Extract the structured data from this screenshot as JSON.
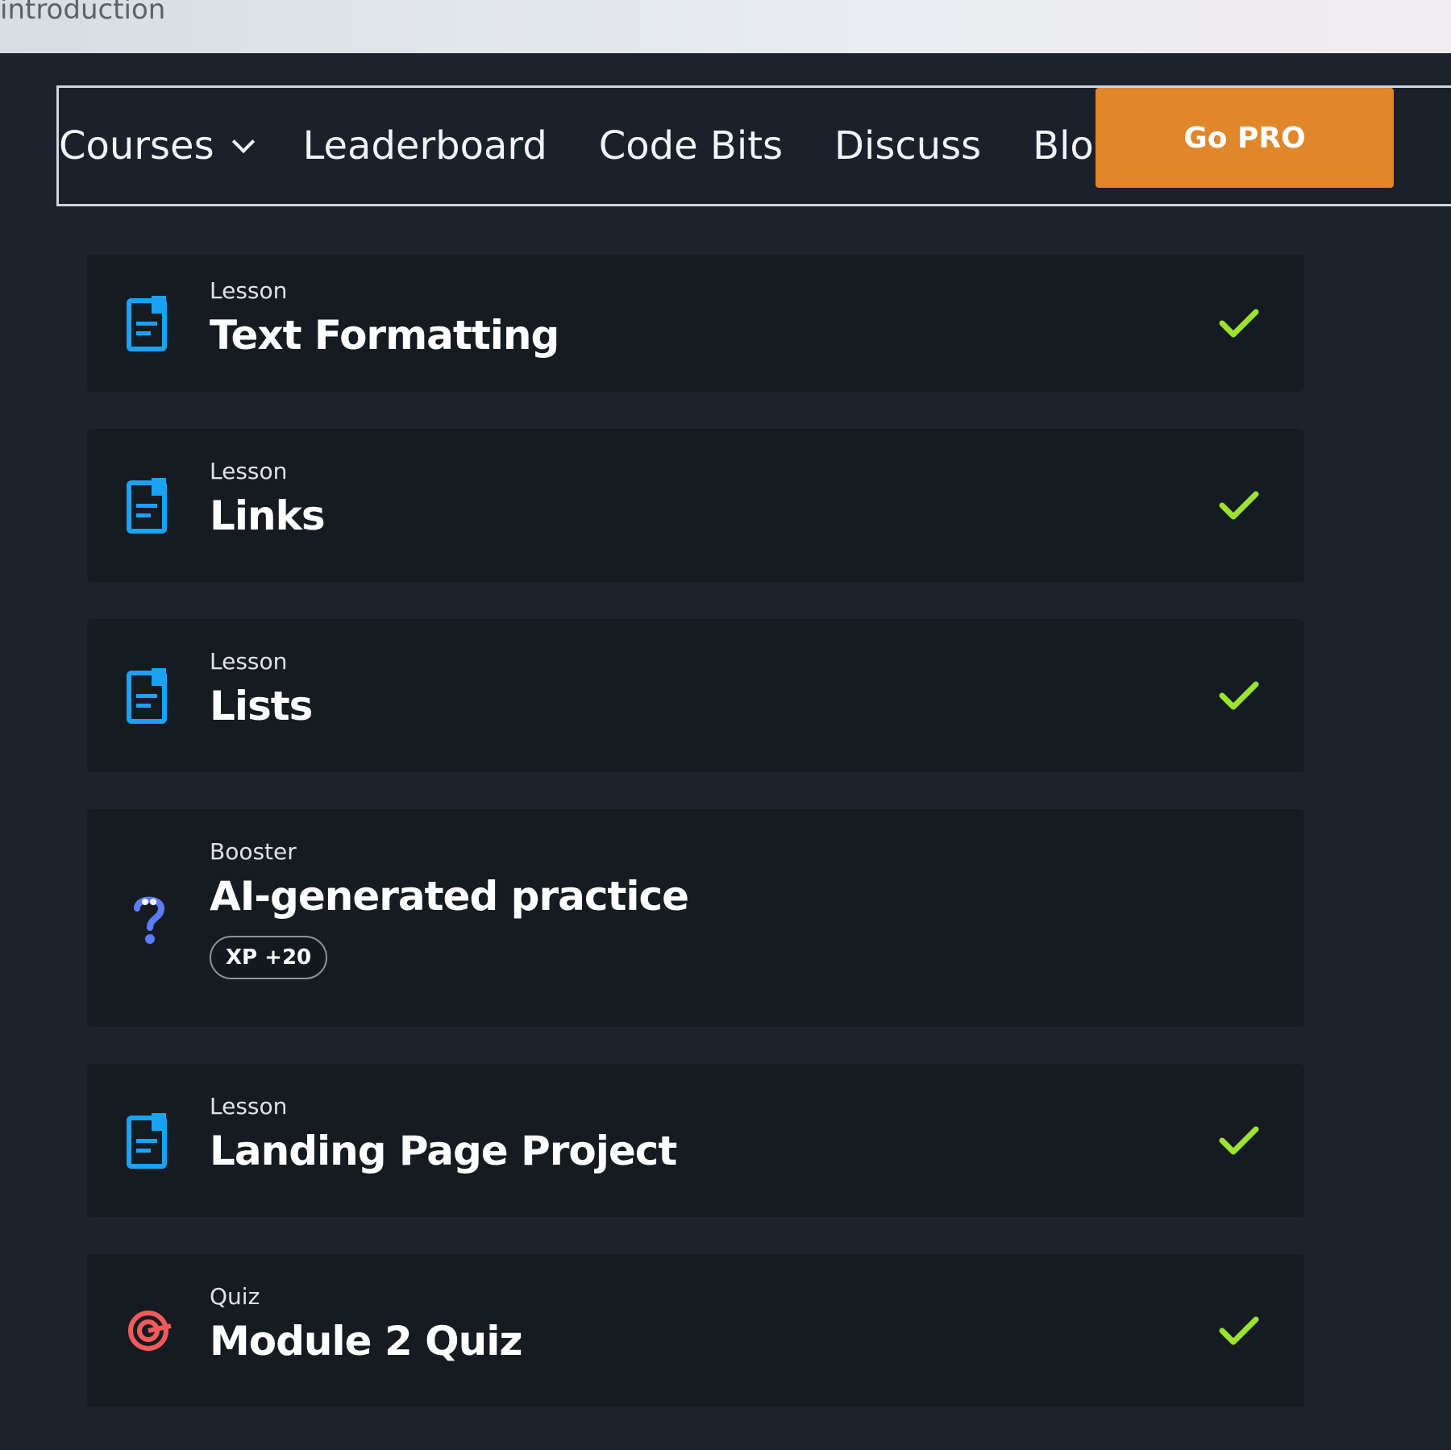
{
  "breadcrumb": "introduction",
  "nav": {
    "items": [
      {
        "label": "Courses",
        "has_dropdown": true
      },
      {
        "label": "Leaderboard"
      },
      {
        "label": "Code Bits"
      },
      {
        "label": "Discuss"
      },
      {
        "label": "Blog"
      }
    ],
    "cta_label": "Go PRO"
  },
  "lessons": [
    {
      "kind": "Lesson",
      "title": "Text Formatting",
      "icon": "lesson-doc-icon",
      "completed": true
    },
    {
      "kind": "Lesson",
      "title": "Links",
      "icon": "lesson-doc-icon",
      "completed": true
    },
    {
      "kind": "Lesson",
      "title": "Lists",
      "icon": "lesson-doc-icon",
      "completed": true
    },
    {
      "kind": "Booster",
      "title": "AI-generated practice",
      "icon": "booster-question-icon",
      "completed": false,
      "badge": "XP +20"
    },
    {
      "kind": "Lesson",
      "title": "Landing Page Project",
      "icon": "lesson-doc-icon",
      "completed": true
    },
    {
      "kind": "Quiz",
      "title": "Module 2 Quiz",
      "icon": "quiz-target-icon",
      "completed": true
    }
  ],
  "colors": {
    "accent_orange": "#e0862b",
    "check_green": "#9be32d",
    "lesson_icon_blue": "#1aa3f2",
    "quiz_icon_red": "#f25a5a"
  }
}
